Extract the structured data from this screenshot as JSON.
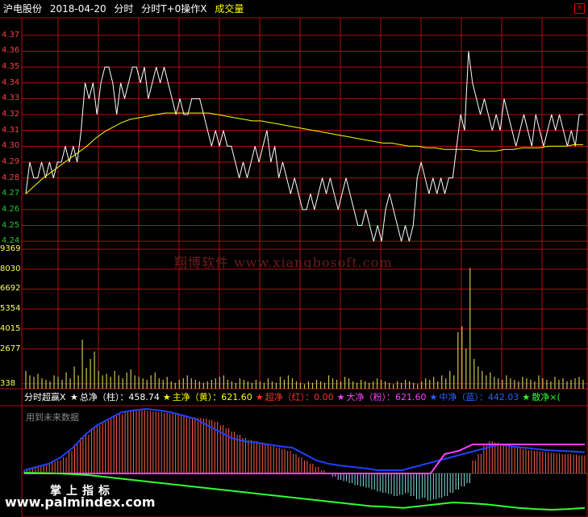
{
  "header": {
    "stock": "沪电股份",
    "date": "2018-04-20",
    "mode": "分时",
    "indicator": "分时T+0操作X",
    "extra": "成交量",
    "close": "X"
  },
  "price_axis": [
    "4.37",
    "4.36",
    "4.35",
    "4.34",
    "4.33",
    "4.32",
    "4.31",
    "4.30",
    "4.29",
    "4.28",
    "4.27",
    "4.26",
    "4.25",
    "4.24"
  ],
  "volume_axis": [
    "9369",
    "8030",
    "6692",
    "5354",
    "4015",
    "2677",
    "338"
  ],
  "legend": {
    "title": "分时超赢X",
    "items": [
      {
        "star": "★",
        "label": "总净（柱）：458.74",
        "color": "#ffffff"
      },
      {
        "star": "★",
        "label": "主净（黄）：621.60",
        "color": "#ffff00"
      },
      {
        "star": "★",
        "label": "超净（红）：0.00",
        "color": "#ff3030"
      },
      {
        "star": "★",
        "label": "大净（粉）：621.60",
        "color": "#ff40ff"
      },
      {
        "star": "★",
        "label": "中净（蓝）：442.03",
        "color": "#3060ff"
      },
      {
        "star": "★",
        "label": "散净×(",
        "color": "#30ff30"
      }
    ]
  },
  "note": "用到未来数据",
  "watermark": "翔博软件 www.xiangbosoft.com",
  "watermark2": "掌上指标",
  "watermark3": "www.palmindex.com",
  "colors": {
    "grid": "#b01010",
    "price": "#ffffff",
    "avg": "#ffff00",
    "up": "#ff4040",
    "down": "#30c030",
    "vol": "#c8c850"
  },
  "chart_data": [
    {
      "type": "line",
      "title": "分时",
      "series_name": "price",
      "ylim": [
        4.235,
        4.375
      ],
      "prices": [
        4.27,
        4.29,
        4.28,
        4.28,
        4.29,
        4.28,
        4.29,
        4.28,
        4.29,
        4.29,
        4.3,
        4.29,
        4.3,
        4.29,
        4.31,
        4.34,
        4.33,
        4.34,
        4.32,
        4.34,
        4.35,
        4.35,
        4.34,
        4.32,
        4.34,
        4.33,
        4.34,
        4.35,
        4.35,
        4.34,
        4.35,
        4.33,
        4.34,
        4.35,
        4.34,
        4.35,
        4.34,
        4.33,
        4.32,
        4.33,
        4.32,
        4.32,
        4.33,
        4.33,
        4.33,
        4.32,
        4.31,
        4.3,
        4.31,
        4.3,
        4.31,
        4.3,
        4.3,
        4.29,
        4.28,
        4.29,
        4.28,
        4.29,
        4.3,
        4.29,
        4.3,
        4.31,
        4.29,
        4.3,
        4.28,
        4.29,
        4.28,
        4.27,
        4.28,
        4.27,
        4.26,
        4.26,
        4.27,
        4.26,
        4.27,
        4.28,
        4.27,
        4.28,
        4.27,
        4.26,
        4.27,
        4.28,
        4.27,
        4.26,
        4.25,
        4.25,
        4.26,
        4.25,
        4.24,
        4.25,
        4.24,
        4.26,
        4.27,
        4.26,
        4.25,
        4.24,
        4.25,
        4.24,
        4.25,
        4.28,
        4.29,
        4.28,
        4.27,
        4.28,
        4.27,
        4.28,
        4.27,
        4.28,
        4.28,
        4.3,
        4.32,
        4.31,
        4.36,
        4.34,
        4.33,
        4.32,
        4.33,
        4.32,
        4.31,
        4.32,
        4.31,
        4.33,
        4.32,
        4.31,
        4.3,
        4.31,
        4.32,
        4.31,
        4.3,
        4.32,
        4.31,
        4.3,
        4.31,
        4.32,
        4.31,
        4.32,
        4.31,
        4.3,
        4.31,
        4.3,
        4.32,
        4.32
      ],
      "avg": [
        4.27,
        4.275,
        4.28,
        4.284,
        4.288,
        4.292,
        4.296,
        4.3,
        4.305,
        4.309,
        4.312,
        4.315,
        4.317,
        4.318,
        4.319,
        4.32,
        4.321,
        4.321,
        4.321,
        4.321,
        4.321,
        4.321,
        4.32,
        4.319,
        4.318,
        4.317,
        4.316,
        4.316,
        4.315,
        4.314,
        4.313,
        4.312,
        4.311,
        4.31,
        4.309,
        4.308,
        4.307,
        4.306,
        4.305,
        4.304,
        4.303,
        4.302,
        4.302,
        4.301,
        4.3,
        4.3,
        4.299,
        4.299,
        4.298,
        4.298,
        4.298,
        4.298,
        4.297,
        4.297,
        4.297,
        4.298,
        4.298,
        4.299,
        4.299,
        4.299,
        4.3,
        4.3,
        4.3,
        4.301,
        4.301
      ],
      "volume_ylim": [
        0,
        9369
      ],
      "volumes": [
        1200,
        900,
        800,
        1000,
        700,
        600,
        500,
        900,
        800,
        600,
        1100,
        700,
        1500,
        900,
        3300,
        1400,
        2000,
        2500,
        1200,
        900,
        1000,
        800,
        1200,
        900,
        700,
        1100,
        1300,
        900,
        800,
        700,
        600,
        900,
        1100,
        700,
        600,
        800,
        500,
        400,
        600,
        700,
        900,
        700,
        600,
        500,
        400,
        500,
        600,
        700,
        800,
        900,
        600,
        500,
        400,
        700,
        600,
        500,
        400,
        600,
        500,
        400,
        700,
        500,
        400,
        800,
        600,
        900,
        700,
        500,
        400,
        300,
        500,
        400,
        600,
        500,
        400,
        900,
        700,
        600,
        500,
        800,
        700,
        500,
        400,
        600,
        500,
        400,
        500,
        700,
        600,
        500,
        400,
        300,
        500,
        400,
        600,
        500,
        400,
        300,
        500,
        700,
        600,
        800,
        500,
        900,
        700,
        1200,
        900,
        3800,
        4200,
        2700,
        8100,
        2000,
        1500,
        1200,
        900,
        1100,
        800,
        700,
        600,
        900,
        700,
        600,
        500,
        800,
        700,
        600,
        500,
        900,
        700,
        600,
        500,
        800,
        600,
        700,
        500,
        600,
        700,
        800,
        600
      ]
    },
    {
      "type": "bar",
      "title": "分时超赢X",
      "values_note": "net bars + lines",
      "bars": [
        0.05,
        0.08,
        0.1,
        0.12,
        0.15,
        0.18,
        0.2,
        0.25,
        0.35,
        0.45,
        0.55,
        0.6,
        0.7,
        0.75,
        0.8,
        0.85,
        0.9,
        0.92,
        0.95,
        0.97,
        0.98,
        0.98,
        0.97,
        0.96,
        0.95,
        0.94,
        0.93,
        0.92,
        0.9,
        0.88,
        0.87,
        0.86,
        0.85,
        0.83,
        0.8,
        0.75,
        0.7,
        0.65,
        0.6,
        0.55,
        0.52,
        0.5,
        0.48,
        0.45,
        0.42,
        0.4,
        0.38,
        0.35,
        0.3,
        0.25,
        0.2,
        0.15,
        0.1,
        0.05,
        0.0,
        -0.05,
        -0.1,
        -0.12,
        -0.15,
        -0.18,
        -0.2,
        -0.22,
        -0.25,
        -0.28,
        -0.3,
        -0.32,
        -0.35,
        -0.33,
        -0.3,
        -0.35,
        -0.4,
        -0.38,
        -0.42,
        -0.4,
        -0.38,
        -0.35,
        -0.3,
        -0.25,
        -0.2,
        -0.15,
        0.2,
        0.3,
        0.45,
        0.5,
        0.48,
        0.46,
        0.44,
        0.42,
        0.4,
        0.38,
        0.36,
        0.35,
        0.34,
        0.33,
        0.32,
        0.31,
        0.3,
        0.3,
        0.29,
        0.28,
        0.28
      ],
      "blue": [
        0.05,
        0.1,
        0.15,
        0.25,
        0.4,
        0.6,
        0.75,
        0.85,
        0.95,
        0.98,
        1.0,
        0.98,
        0.95,
        0.9,
        0.85,
        0.75,
        0.65,
        0.55,
        0.5,
        0.48,
        0.45,
        0.42,
        0.4,
        0.3,
        0.2,
        0.15,
        0.12,
        0.1,
        0.08,
        0.05,
        0.05,
        0.05,
        0.1,
        0.15,
        0.2,
        0.25,
        0.3,
        0.35,
        0.4,
        0.45,
        0.42,
        0.4,
        0.38,
        0.36,
        0.35,
        0.34,
        0.33
      ],
      "pink": [
        0,
        0,
        0,
        0,
        0,
        0,
        0,
        0,
        0,
        0,
        0,
        0,
        0,
        0,
        0,
        0,
        0,
        0,
        0,
        0,
        0,
        0,
        0,
        0,
        0,
        0,
        0,
        0,
        0,
        0,
        0.3,
        0.35,
        0.45,
        0.45,
        0.45,
        0.45,
        0.45,
        0.45,
        0.45,
        0.45,
        0.45
      ],
      "green": [
        0.02,
        0.01,
        0,
        -0.02,
        -0.05,
        -0.1,
        -0.15,
        -0.2,
        -0.25,
        -0.3,
        -0.35,
        -0.4,
        -0.45,
        -0.5,
        -0.55,
        -0.6,
        -0.65,
        -0.7,
        -0.75,
        -0.8,
        -0.85,
        -0.9,
        -0.92,
        -0.95,
        -0.9,
        -0.85,
        -0.8,
        -0.82,
        -0.85,
        -0.9,
        -0.95,
        -0.98,
        -1.0,
        -0.98,
        -0.95
      ]
    }
  ]
}
